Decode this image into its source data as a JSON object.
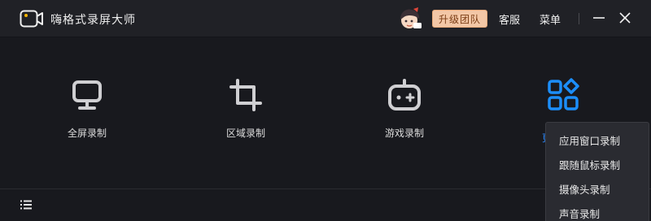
{
  "app": {
    "title": "嗨格式录屏大师",
    "upgrade_label": "升级团队",
    "service_label": "客服",
    "menu_label": "菜单"
  },
  "icons": {
    "logo": "video-camera-icon",
    "minimize": "minimize-icon",
    "close": "close-icon",
    "avatar": "user-avatar-icon",
    "list": "list-icon"
  },
  "modes": [
    {
      "label": "全屏录制",
      "icon": "monitor-icon"
    },
    {
      "label": "区域录制",
      "icon": "crop-icon"
    },
    {
      "label": "游戏录制",
      "icon": "gamepad-icon"
    },
    {
      "label": "更",
      "icon": "apps-grid-icon"
    }
  ],
  "dropdown": {
    "items": [
      "应用窗口录制",
      "跟随鼠标录制",
      "摄像头录制",
      "声音录制"
    ]
  },
  "colors": {
    "background": "#18191e",
    "titlebar": "#202126",
    "accent_blue": "#1c8ef9",
    "upgrade_bg": "#f3c7a6",
    "upgrade_text": "#7a3c14",
    "logo_dot": "#f5b400"
  }
}
